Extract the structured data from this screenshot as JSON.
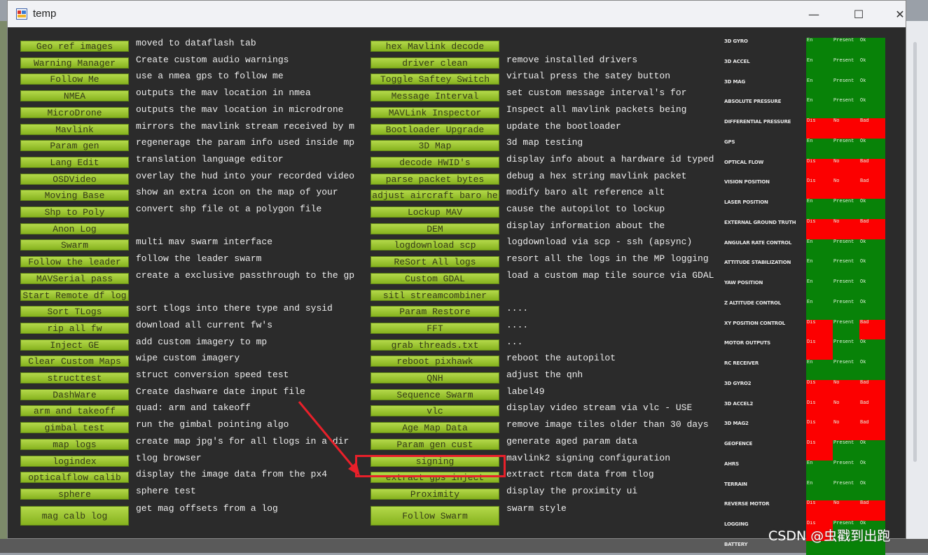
{
  "window": {
    "title": "temp"
  },
  "col1": [
    {
      "label": "Geo ref images",
      "desc": "moved to dataflash tab"
    },
    {
      "label": "Warning Manager",
      "desc": "Create custom audio warnings"
    },
    {
      "label": "Follow Me",
      "desc": "use a nmea gps to follow me"
    },
    {
      "label": "NMEA",
      "desc": "outputs the mav location in nmea"
    },
    {
      "label": "MicroDrone",
      "desc": "outputs the mav location in microdrone"
    },
    {
      "label": "Mavlink",
      "desc": "mirrors the mavlink stream received by mp"
    },
    {
      "label": "Param gen",
      "desc": "regenerage the param info used inside mp"
    },
    {
      "label": "Lang Edit",
      "desc": "translation language editor"
    },
    {
      "label": "OSDVideo",
      "desc": "overlay the hud into your recorded videos"
    },
    {
      "label": "Moving Base",
      "desc": "show an extra icon on the map of your"
    },
    {
      "label": "Shp to Poly",
      "desc": "convert shp file ot a polygon file"
    },
    {
      "label": "Anon Log",
      "desc": ""
    },
    {
      "label": "Swarm",
      "desc": "multi mav swarm interface"
    },
    {
      "label": "Follow the leader",
      "desc": "follow the leader swarm"
    },
    {
      "label": "MAVSerial pass",
      "desc": "create a exclusive passthrough to the gps"
    },
    {
      "label": "Start Remote df log",
      "desc": ""
    },
    {
      "label": "Sort TLogs",
      "desc": "sort tlogs into there type and sysid"
    },
    {
      "label": "rip all fw",
      "desc": "download all current fw's"
    },
    {
      "label": "Inject GE",
      "desc": "add custom imagery to mp"
    },
    {
      "label": "Clear Custom Maps",
      "desc": "wipe custom imagery"
    },
    {
      "label": "structtest",
      "desc": "struct conversion speed test"
    },
    {
      "label": "DashWare",
      "desc": "Create dashware date input file"
    },
    {
      "label": "arm and takeoff",
      "desc": "quad: arm and takeoff"
    },
    {
      "label": "gimbal test",
      "desc": "run the gimbal pointing algo"
    },
    {
      "label": "map logs",
      "desc": "create map jpg's for all tlogs in a dir"
    },
    {
      "label": "logindex",
      "desc": "tlog browser"
    },
    {
      "label": "opticalflow calib",
      "desc": "display the image data from the px4"
    },
    {
      "label": "sphere",
      "desc": "sphere test"
    },
    {
      "label": "mag calb log",
      "desc": "get mag offsets from a log"
    }
  ],
  "col2": [
    {
      "label": "hex Mavlink decode",
      "desc": ""
    },
    {
      "label": "driver clean",
      "desc": "remove installed drivers"
    },
    {
      "label": "Toggle Saftey Switch",
      "desc": "virtual press the satey button"
    },
    {
      "label": "Message Interval",
      "desc": "set custom message interval's for"
    },
    {
      "label": "MAVLink Inspector",
      "desc": "Inspect all mavlink packets being"
    },
    {
      "label": "Bootloader Upgrade",
      "desc": "update the bootloader"
    },
    {
      "label": "3D Map",
      "desc": "3d map testing"
    },
    {
      "label": "decode HWID's",
      "desc": "display info about a hardware id typed"
    },
    {
      "label": "parse packet bytes",
      "desc": "debug a hex string mavlink packet"
    },
    {
      "label": "adjust aircraft baro he",
      "desc": "modify baro alt reference alt"
    },
    {
      "label": "Lockup MAV",
      "desc": "cause the autopilot to lockup"
    },
    {
      "label": "DEM",
      "desc": "display information about the"
    },
    {
      "label": "logdownload scp",
      "desc": "logdownload via scp - ssh (apsync)"
    },
    {
      "label": "ReSort All logs",
      "desc": "resort all the logs in the MP logging"
    },
    {
      "label": "Custom GDAL",
      "desc": "load a custom map tile source via GDAL"
    },
    {
      "label": "sitl streamcombiner",
      "desc": ""
    },
    {
      "label": "Param Restore",
      "desc": "...."
    },
    {
      "label": "FFT",
      "desc": "...."
    },
    {
      "label": "grab threads.txt",
      "desc": "..."
    },
    {
      "label": "reboot pixhawk",
      "desc": "reboot the autopilot"
    },
    {
      "label": "QNH",
      "desc": "adjust the qnh"
    },
    {
      "label": "Sequence Swarm",
      "desc": "label49"
    },
    {
      "label": "vlc",
      "desc": "display video stream via vlc - USE"
    },
    {
      "label": "Age Map Data",
      "desc": "remove image tiles older than 30 days"
    },
    {
      "label": "Param gen cust",
      "desc": "generate aged param data"
    },
    {
      "label": "signing",
      "desc": "mavlink2 signing configuration"
    },
    {
      "label": "extract gps inject",
      "desc": "extract rtcm data from tlog"
    },
    {
      "label": "Proximity",
      "desc": "display the proximity ui"
    },
    {
      "label": "Follow Swarm",
      "desc": "swarm style"
    }
  ],
  "sensors": [
    {
      "name": "3D GYRO",
      "c1": "En",
      "c2": "Present",
      "c3": "Ok",
      "s1": "green",
      "s2": "green",
      "s3": "green"
    },
    {
      "name": "3D ACCEL",
      "c1": "En",
      "c2": "Present",
      "c3": "Ok",
      "s1": "green",
      "s2": "green",
      "s3": "green"
    },
    {
      "name": "3D MAG",
      "c1": "En",
      "c2": "Present",
      "c3": "Ok",
      "s1": "green",
      "s2": "green",
      "s3": "green"
    },
    {
      "name": "ABSOLUTE PRESSURE",
      "c1": "En",
      "c2": "Present",
      "c3": "Ok",
      "s1": "green",
      "s2": "green",
      "s3": "green"
    },
    {
      "name": "DIFFERENTIAL PRESSURE",
      "c1": "Dis",
      "c2": "No",
      "c3": "Bad",
      "s1": "red",
      "s2": "red",
      "s3": "red"
    },
    {
      "name": "GPS",
      "c1": "En",
      "c2": "Present",
      "c3": "Ok",
      "s1": "green",
      "s2": "green",
      "s3": "green"
    },
    {
      "name": "OPTICAL FLOW",
      "c1": "Dis",
      "c2": "No",
      "c3": "Bad",
      "s1": "red",
      "s2": "red",
      "s3": "red"
    },
    {
      "name": "VISION POSITION",
      "c1": "Dis",
      "c2": "No",
      "c3": "Bad",
      "s1": "red",
      "s2": "red",
      "s3": "red"
    },
    {
      "name": "LASER POSITION",
      "c1": "En",
      "c2": "Present",
      "c3": "Ok",
      "s1": "green",
      "s2": "green",
      "s3": "green"
    },
    {
      "name": "EXTERNAL GROUND TRUTH",
      "c1": "Dis",
      "c2": "No",
      "c3": "Bad",
      "s1": "red",
      "s2": "red",
      "s3": "red"
    },
    {
      "name": "ANGULAR RATE CONTROL",
      "c1": "En",
      "c2": "Present",
      "c3": "Ok",
      "s1": "green",
      "s2": "green",
      "s3": "green"
    },
    {
      "name": "ATTITUDE STABILIZATION",
      "c1": "En",
      "c2": "Present",
      "c3": "Ok",
      "s1": "green",
      "s2": "green",
      "s3": "green"
    },
    {
      "name": "YAW POSITION",
      "c1": "En",
      "c2": "Present",
      "c3": "Ok",
      "s1": "green",
      "s2": "green",
      "s3": "green"
    },
    {
      "name": "Z ALTITUDE CONTROL",
      "c1": "En",
      "c2": "Present",
      "c3": "Ok",
      "s1": "green",
      "s2": "green",
      "s3": "green"
    },
    {
      "name": "XY POSITION CONTROL",
      "c1": "Dis",
      "c2": "Present",
      "c3": "Bad",
      "s1": "red",
      "s2": "green",
      "s3": "red"
    },
    {
      "name": "MOTOR OUTPUTS",
      "c1": "Dis",
      "c2": "Present",
      "c3": "Ok",
      "s1": "red",
      "s2": "green",
      "s3": "green"
    },
    {
      "name": "RC RECEIVER",
      "c1": "En",
      "c2": "Present",
      "c3": "Ok",
      "s1": "green",
      "s2": "green",
      "s3": "green"
    },
    {
      "name": "3D GYRO2",
      "c1": "Dis",
      "c2": "No",
      "c3": "Bad",
      "s1": "red",
      "s2": "red",
      "s3": "red"
    },
    {
      "name": "3D ACCEL2",
      "c1": "Dis",
      "c2": "No",
      "c3": "Bad",
      "s1": "red",
      "s2": "red",
      "s3": "red"
    },
    {
      "name": "3D MAG2",
      "c1": "Dis",
      "c2": "No",
      "c3": "Bad",
      "s1": "red",
      "s2": "red",
      "s3": "red"
    },
    {
      "name": "GEOFENCE",
      "c1": "Dis",
      "c2": "Present",
      "c3": "Ok",
      "s1": "red",
      "s2": "green",
      "s3": "green"
    },
    {
      "name": "AHRS",
      "c1": "En",
      "c2": "Present",
      "c3": "Ok",
      "s1": "green",
      "s2": "green",
      "s3": "green"
    },
    {
      "name": "TERRAIN",
      "c1": "En",
      "c2": "Present",
      "c3": "Ok",
      "s1": "green",
      "s2": "green",
      "s3": "green"
    },
    {
      "name": "REVERSE MOTOR",
      "c1": "Dis",
      "c2": "No",
      "c3": "Bad",
      "s1": "red",
      "s2": "red",
      "s3": "red"
    },
    {
      "name": "LOGGING",
      "c1": "Dis",
      "c2": "Present",
      "c3": "Ok",
      "s1": "red",
      "s2": "green",
      "s3": "green"
    },
    {
      "name": "BATTERY",
      "c1": "",
      "c2": "",
      "c3": "",
      "s1": "green",
      "s2": "green",
      "s3": "green"
    }
  ],
  "colors": {
    "button": "#a4cc34",
    "background": "#2b2b2b",
    "ok": "#088208",
    "bad": "#fc0000",
    "highlight": "#e8202a"
  },
  "watermark": "CSDN @虫戳到出跑"
}
